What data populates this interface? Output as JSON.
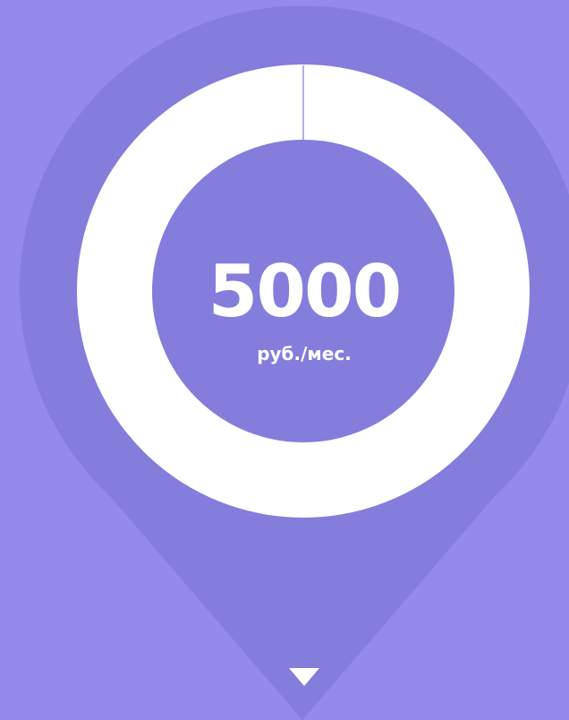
{
  "price": {
    "amount": "5000",
    "unit": "руб./мес."
  },
  "icons": {
    "pin": "map-pin-icon",
    "ring": "progress-ring-icon",
    "arrow": "triangle-down-icon"
  },
  "colors": {
    "background": "#938aea",
    "pin": "#847ddc",
    "ring": "#ffffff",
    "text": "#ffffff"
  }
}
